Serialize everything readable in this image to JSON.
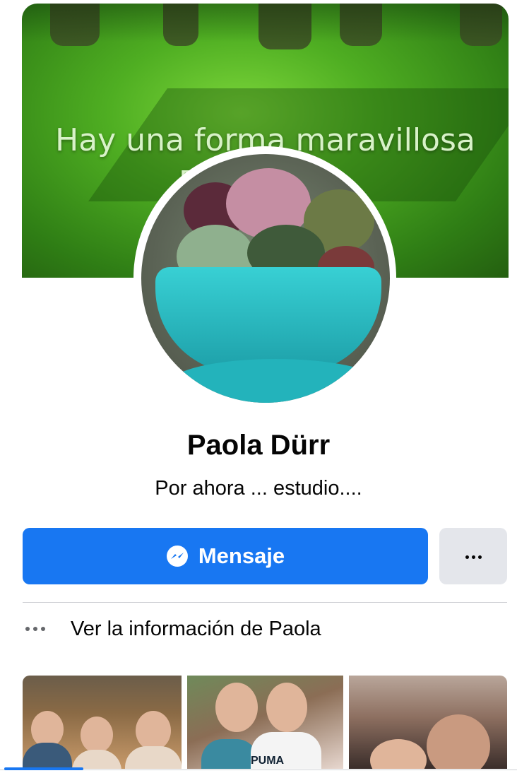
{
  "cover": {
    "line1": "Hay una forma maravillosa",
    "line2": "Para e                 l día"
  },
  "profile": {
    "name": "Paola Dürr",
    "bio": "Por ahora ... estudio...."
  },
  "actions": {
    "message_label": "Mensaje",
    "more_icon": "ellipsis-icon"
  },
  "info": {
    "label": "Ver la información de Paola",
    "icon": "more-dots-icon"
  },
  "photos": {
    "p2_shirt_text": "PUMA"
  },
  "colors": {
    "primary": "#1877f2",
    "secondary_button": "#e4e6eb",
    "text": "#050505",
    "muted": "#65676b"
  }
}
